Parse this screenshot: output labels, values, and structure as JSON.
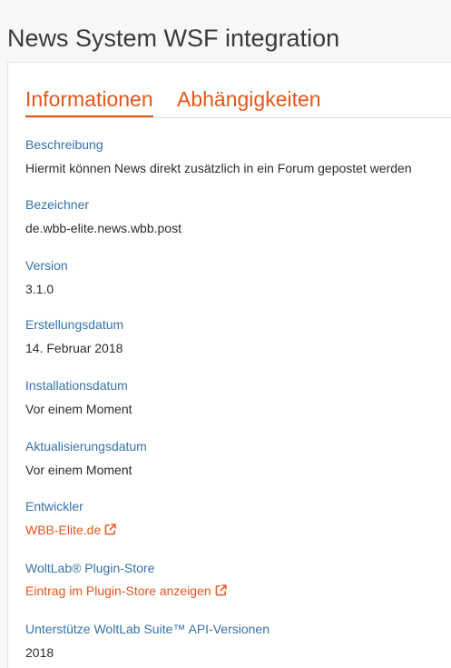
{
  "page": {
    "title": "News System WSF integration"
  },
  "tabs": [
    {
      "label": "Informationen",
      "active": true
    },
    {
      "label": "Abhängigkeiten",
      "active": false
    }
  ],
  "fields": {
    "description": {
      "label": "Beschreibung",
      "value": "Hiermit können News direkt zusätzlich in ein Forum gepostet werden"
    },
    "identifier": {
      "label": "Bezeichner",
      "value": "de.wbb-elite.news.wbb.post"
    },
    "version": {
      "label": "Version",
      "value": "3.1.0"
    },
    "created": {
      "label": "Erstellungsdatum",
      "value": "14. Februar 2018"
    },
    "installed": {
      "label": "Installationsdatum",
      "value": "Vor einem Moment"
    },
    "updated": {
      "label": "Aktualisierungsdatum",
      "value": "Vor einem Moment"
    },
    "developer": {
      "label": "Entwickler",
      "link_text": "WBB-Elite.de",
      "icon": "external-link-icon"
    },
    "plugin_store": {
      "label": "WoltLab® Plugin-Store",
      "link_text": "Eintrag im Plugin-Store anzeigen",
      "icon": "external-link-icon"
    },
    "api_versions": {
      "label": "Unterstütze WoltLab Suite™ API-Versionen",
      "value": "2018"
    }
  },
  "colors": {
    "accent": "#e2571b",
    "label": "#3872a8",
    "text": "#2d2d2d"
  }
}
